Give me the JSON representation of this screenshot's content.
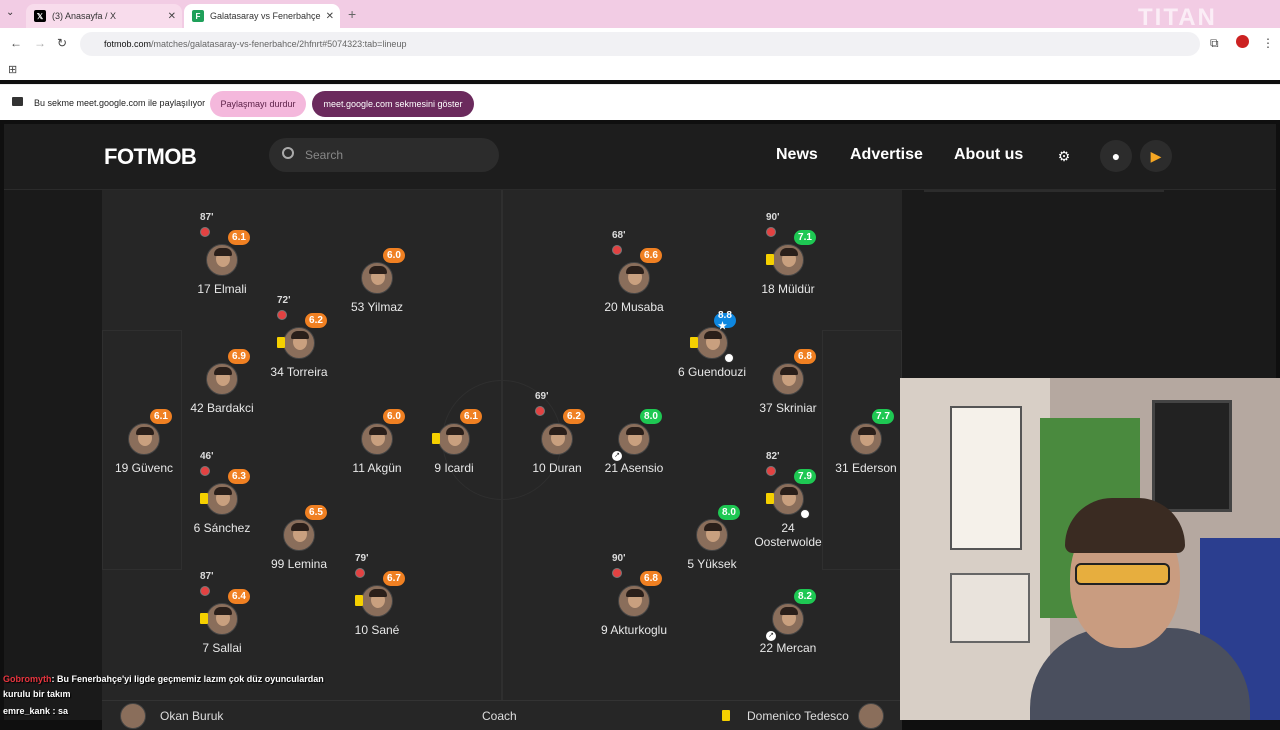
{
  "browser": {
    "tabs": [
      {
        "title": "(3) Anasayfa / X",
        "favicon": "x-icon"
      },
      {
        "title": "Galatasaray vs Fenerbahçe",
        "favicon": "fotmob-icon"
      }
    ],
    "url_host": "fotmob.com",
    "url_path": "/matches/galatasaray-vs-fenerbahce/2hfnrt#5074323:tab=lineup"
  },
  "share_bar": {
    "text": "Bu sekme meet.google.com ile paylaşılıyor",
    "stop_label": "Paylaşmayı durdur",
    "show_label": "meet.google.com sekmesini göster"
  },
  "site": {
    "logo": "FOTMOB",
    "search_placeholder": "Search",
    "nav": [
      "News",
      "Advertise",
      "About us"
    ]
  },
  "home_players": [
    {
      "name": "17 Elmali",
      "rating": "6.1",
      "sub": "87'"
    },
    {
      "name": "53 Yilmaz",
      "rating": "6.0"
    },
    {
      "name": "34 Torreira",
      "rating": "6.2",
      "sub": "72'"
    },
    {
      "name": "42 Bardakci",
      "rating": "6.9"
    },
    {
      "name": "19 Güvenc",
      "rating": "6.1"
    },
    {
      "name": "11 Akgün",
      "rating": "6.0"
    },
    {
      "name": "9 Icardi",
      "rating": "6.1"
    },
    {
      "name": "6 Sánchez",
      "rating": "6.3",
      "sub": "46'"
    },
    {
      "name": "99 Lemina",
      "rating": "6.5"
    },
    {
      "name": "7 Sallai",
      "rating": "6.4",
      "sub": "87'"
    },
    {
      "name": "10 Sané",
      "rating": "6.7",
      "sub": "79'"
    }
  ],
  "away_players": [
    {
      "name": "20 Musaba",
      "rating": "6.6",
      "sub": "68'"
    },
    {
      "name": "18 Müldür",
      "rating": "7.1",
      "sub": "90'"
    },
    {
      "name": "6 Guendouzi",
      "rating": "8.8"
    },
    {
      "name": "37 Skriniar",
      "rating": "6.8"
    },
    {
      "name": "10 Duran",
      "rating": "6.2",
      "sub": "69'"
    },
    {
      "name": "21 Asensio",
      "rating": "8.0"
    },
    {
      "name": "31 Ederson",
      "rating": "7.7"
    },
    {
      "name": "24",
      "name2": "Oosterwolde",
      "rating": "7.9",
      "sub": "82'"
    },
    {
      "name": "5 Yüksek",
      "rating": "8.0"
    },
    {
      "name": "9 Akturkoglu",
      "rating": "6.8",
      "sub": "90'"
    },
    {
      "name": "22 Mercan",
      "rating": "8.2"
    }
  ],
  "coaches": {
    "home": "Okan Buruk",
    "label": "Coach",
    "away": "Domenico Tedesco"
  },
  "chat": [
    {
      "nick": "Gobromyth",
      "msg": ": Bu Fenerbahçe'yi ligde geçmemiz lazım çok düz oyunculardan"
    },
    {
      "nick": "",
      "msg": "kurulu bir takım"
    },
    {
      "nick": "emre_kank",
      "msg": " : sa"
    }
  ],
  "watermark": "TITAN"
}
